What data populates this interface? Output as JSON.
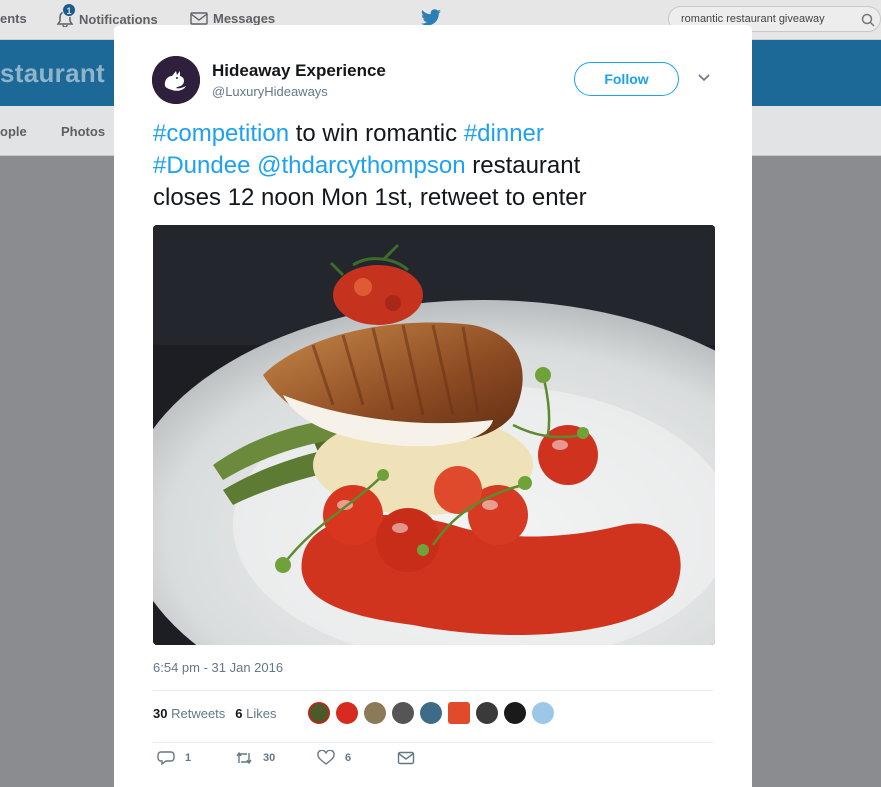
{
  "topbar": {
    "nav_items": [
      "ents",
      "Notifications",
      "Messages"
    ],
    "notification_count": "1",
    "search_value": "romantic restaurant giveaway"
  },
  "banner": {
    "title": "staurant"
  },
  "subnav": {
    "items": [
      "ople",
      "Photos"
    ]
  },
  "tweet": {
    "author_name": "Hideaway Experience",
    "author_handle": "@LuxuryHideaways",
    "follow_label": "Follow",
    "text": {
      "competition": "#competition",
      "to_win": " to win romantic ",
      "dinner": "#dinner",
      "dundee": "#Dundee",
      "mention": "@thdarcythompson",
      "restaurant": " restaurant",
      "closes": "closes 12 noon Mon 1st, retweet to enter"
    },
    "timestamp": "6:54 pm - 31 Jan 2016",
    "retweets_count": "30",
    "retweets_label": "Retweets",
    "likes_count": "6",
    "likes_label": "Likes",
    "actions": {
      "reply_count": "1",
      "retweet_count": "30",
      "like_count": "6"
    }
  },
  "colors": {
    "accent": "#1da1f2",
    "banner": "#1c6896",
    "text": "#14171a",
    "muted": "#657786"
  }
}
